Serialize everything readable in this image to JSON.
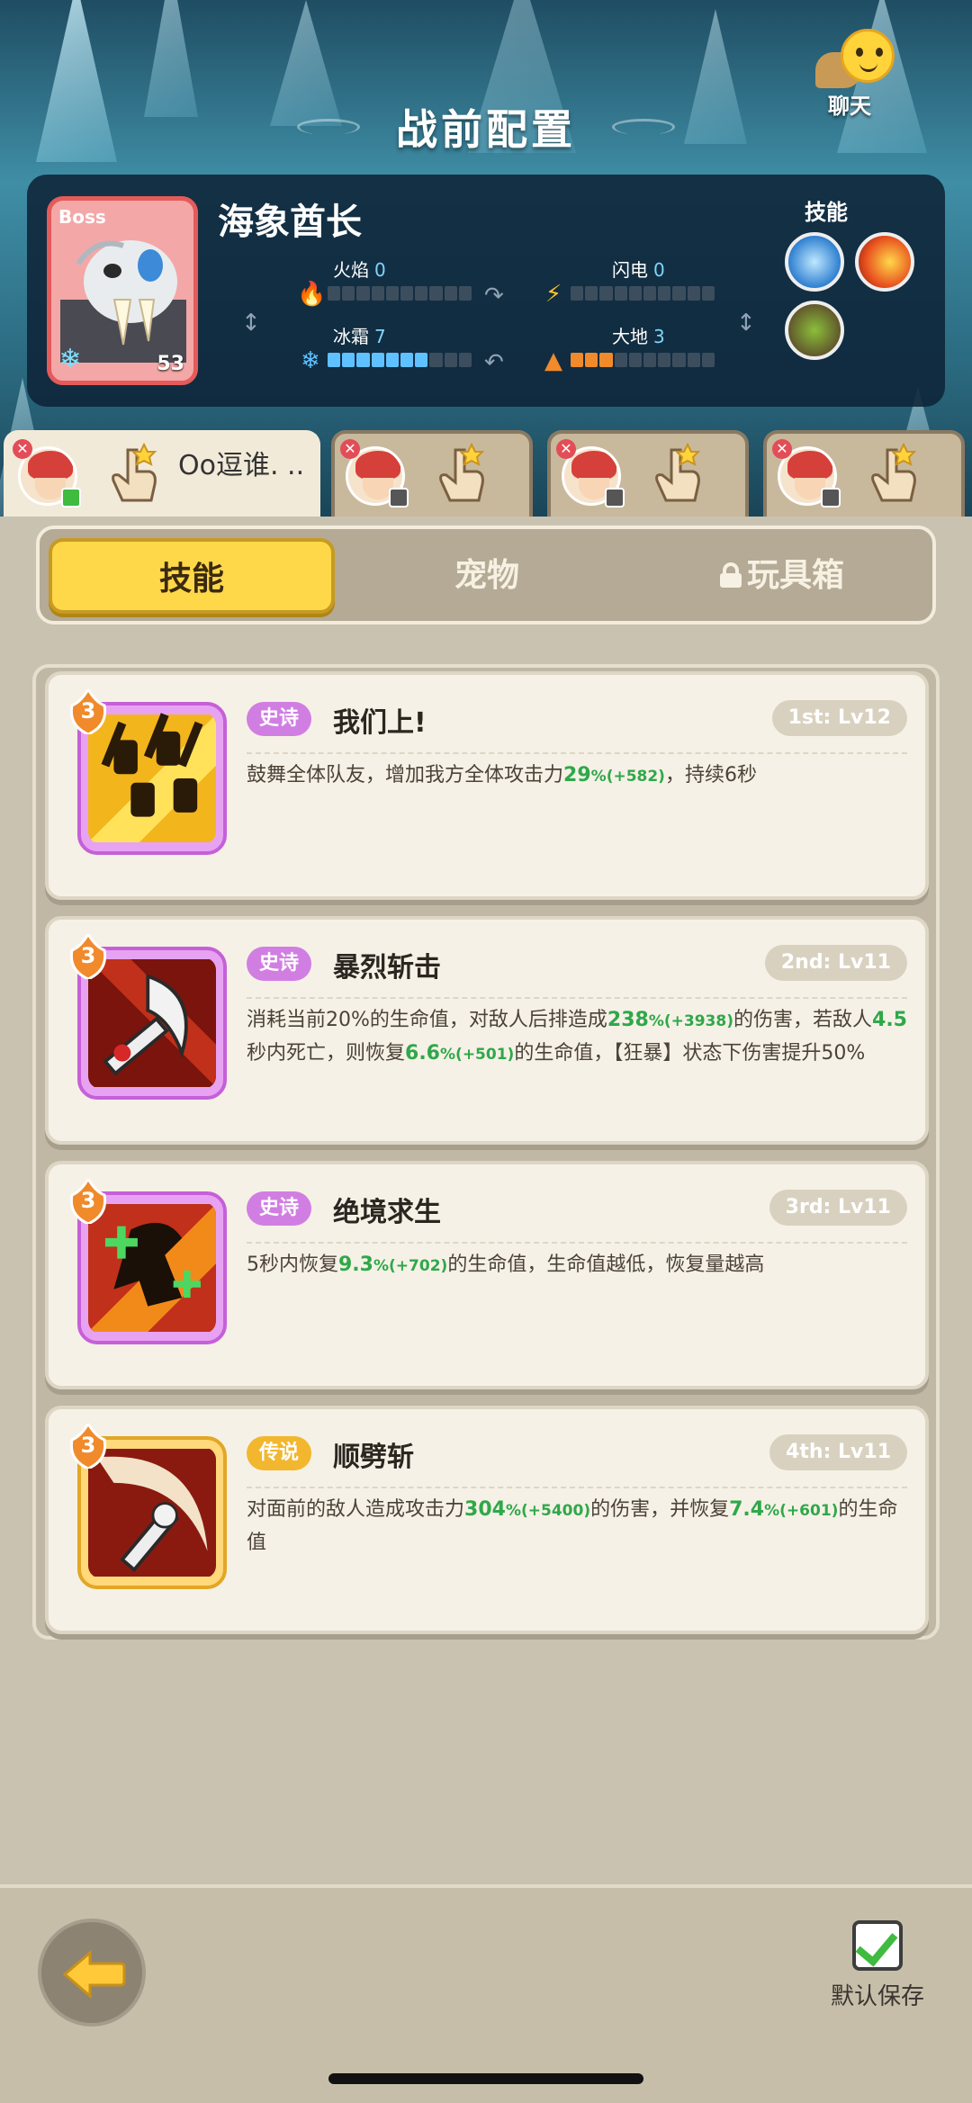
{
  "header": {
    "title": "战前配置",
    "chat_label": "聊天"
  },
  "boss": {
    "tag": "Boss",
    "name": "海象酋长",
    "level": "53",
    "skills_label": "技能",
    "stats": [
      {
        "label": "火焰",
        "value": "0",
        "filled": 0,
        "color": "#e04b33",
        "icon": "flame-icon"
      },
      {
        "label": "闪电",
        "value": "0",
        "filled": 0,
        "color": "#ffc42b",
        "icon": "lightning-icon"
      },
      {
        "label": "冰霜",
        "value": "7",
        "filled": 7,
        "color": "#5fc1ff",
        "icon": "snowflake-icon"
      },
      {
        "label": "大地",
        "value": "3",
        "filled": 3,
        "color": "#f08a2a",
        "icon": "mountain-icon"
      }
    ]
  },
  "players": [
    {
      "name": "Oo逗谁. ..",
      "active": true
    },
    {
      "name": "",
      "active": false
    },
    {
      "name": "",
      "active": false
    },
    {
      "name": "",
      "active": false
    }
  ],
  "tabs": [
    {
      "label": "技能",
      "active": true,
      "locked": false
    },
    {
      "label": "宠物",
      "active": false,
      "locked": false
    },
    {
      "label": "玩具箱",
      "active": false,
      "locked": true
    }
  ],
  "skills": [
    {
      "star": "3",
      "rarity": "史诗",
      "rarity_type": "epic",
      "name": "我们上!",
      "rank": "1st: Lv12",
      "desc_parts": [
        {
          "t": "鼓舞全体队友，增加我方全体攻击力"
        },
        {
          "t": "29",
          "g": true
        },
        {
          "t": "%",
          "g": true,
          "s": true
        },
        {
          "t": "(+582)",
          "g": true,
          "s": true
        },
        {
          "t": "，持续6秒"
        }
      ]
    },
    {
      "star": "3",
      "rarity": "史诗",
      "rarity_type": "epic",
      "name": "暴烈斩击",
      "rank": "2nd: Lv11",
      "desc_parts": [
        {
          "t": "消耗当前20%的生命值，对敌人后排造成"
        },
        {
          "t": "238",
          "g": true
        },
        {
          "t": "%",
          "g": true,
          "s": true
        },
        {
          "t": "(+3938)",
          "g": true,
          "s": true
        },
        {
          "t": "的伤害，若敌人"
        },
        {
          "t": "4.5",
          "g": true
        },
        {
          "t": "秒内死亡，则恢复"
        },
        {
          "t": "6.6",
          "g": true
        },
        {
          "t": "%",
          "g": true,
          "s": true
        },
        {
          "t": "(+501)",
          "g": true,
          "s": true
        },
        {
          "t": "的生命值，【狂暴】状态下伤害提升50%"
        }
      ]
    },
    {
      "star": "3",
      "rarity": "史诗",
      "rarity_type": "epic",
      "name": "绝境求生",
      "rank": "3rd: Lv11",
      "desc_parts": [
        {
          "t": "5秒内恢复"
        },
        {
          "t": "9.3",
          "g": true
        },
        {
          "t": "%",
          "g": true,
          "s": true
        },
        {
          "t": "(+702)",
          "g": true,
          "s": true
        },
        {
          "t": "的生命值，生命值越低，恢复量越高"
        }
      ]
    },
    {
      "star": "3",
      "rarity": "传说",
      "rarity_type": "legend",
      "name": "顺劈斩",
      "rank": "4th: Lv11",
      "desc_parts": [
        {
          "t": "对面前的敌人造成攻击力"
        },
        {
          "t": "304",
          "g": true
        },
        {
          "t": "%",
          "g": true,
          "s": true
        },
        {
          "t": "(+5400)",
          "g": true,
          "s": true
        },
        {
          "t": "的伤害，并恢复"
        },
        {
          "t": "7.4",
          "g": true
        },
        {
          "t": "%",
          "g": true,
          "s": true
        },
        {
          "t": "(+601)",
          "g": true,
          "s": true
        },
        {
          "t": "的生命值"
        }
      ]
    }
  ],
  "footer": {
    "save_label": "默认保存"
  }
}
